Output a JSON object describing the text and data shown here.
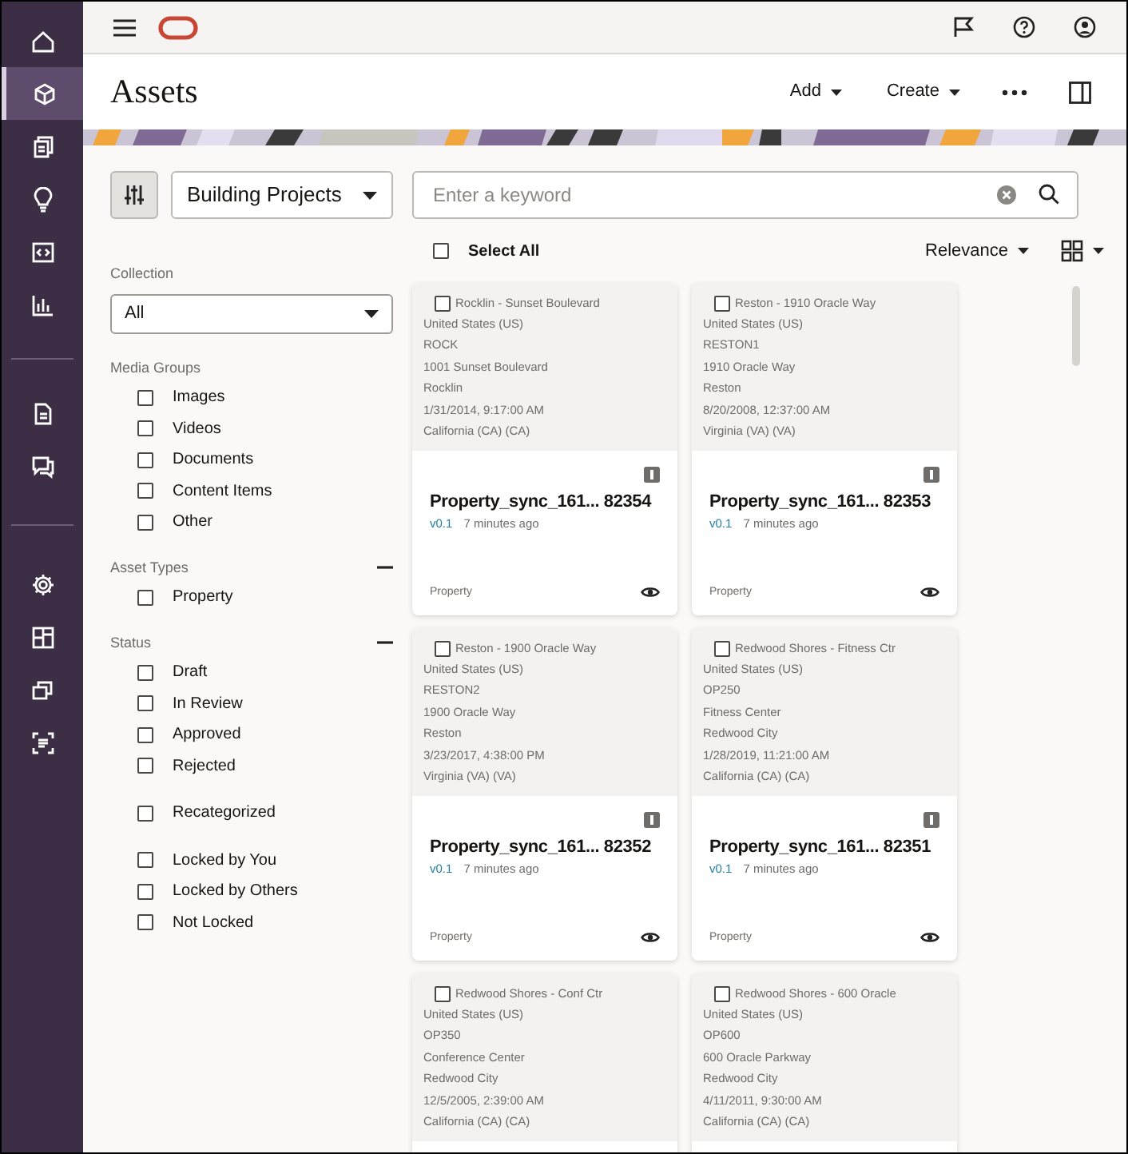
{
  "rail": {
    "items": [
      {
        "selected": false
      },
      {
        "selected": true
      },
      {
        "selected": false
      },
      {
        "selected": false
      },
      {
        "selected": false
      },
      {
        "selected": false
      },
      {
        "selected": false
      },
      {
        "selected": false
      },
      {
        "selected": false
      },
      {
        "selected": false
      },
      {
        "selected": false
      },
      {
        "selected": false
      }
    ]
  },
  "header": {
    "title": "Assets",
    "actions": [
      "Add",
      "Create"
    ]
  },
  "filters": {
    "repository": "Building Projects",
    "collection_label": "Collection",
    "collection": "All",
    "sections": [
      {
        "title": "Media Groups",
        "groups": [
          [
            {
              "label": "Images",
              "checked": false
            },
            {
              "label": "Videos",
              "checked": false
            },
            {
              "label": "Documents",
              "checked": false
            },
            {
              "label": "Content Items",
              "checked": false
            },
            {
              "label": "Other",
              "checked": false
            }
          ]
        ]
      },
      {
        "title": "Asset Types",
        "expanded": true,
        "groups": [
          [
            {
              "label": "Property",
              "checked": false
            }
          ]
        ]
      },
      {
        "title": "Status",
        "expanded": true,
        "groups": [
          [
            {
              "label": "Draft",
              "checked": false
            },
            {
              "label": "In Review",
              "checked": false
            },
            {
              "label": "Approved",
              "checked": false
            },
            {
              "label": "Rejected",
              "checked": false
            }
          ],
          [
            {
              "label": "Recategorized",
              "checked": false
            }
          ],
          [
            {
              "label": "Locked by You",
              "checked": false
            },
            {
              "label": "Locked by Others",
              "checked": false
            },
            {
              "label": "Not Locked",
              "checked": false
            }
          ]
        ]
      }
    ]
  },
  "search": {
    "placeholder": "Enter a keyword"
  },
  "toolbar": {
    "select_all": {
      "label": "Select All",
      "checked": false
    },
    "sort": "Relevance"
  },
  "cards": [
    {
      "checked": false,
      "title": "Rocklin - Sunset Boulevard",
      "lines": [
        "United States (US)",
        "ROCK",
        "1001 Sunset Boulevard",
        "Rocklin",
        "1/31/2014, 9:17:00 AM",
        "California (CA) (CA)"
      ],
      "name": "Property_sync_161... 82354",
      "version": "v0.1",
      "time": "7 minutes ago",
      "type": "Property"
    },
    {
      "checked": false,
      "title": "Reston - 1910 Oracle Way",
      "lines": [
        "United States (US)",
        "RESTON1",
        "1910 Oracle Way",
        "Reston",
        "8/20/2008, 12:37:00 AM",
        "Virginia (VA) (VA)"
      ],
      "name": "Property_sync_161... 82353",
      "version": "v0.1",
      "time": "7 minutes ago",
      "type": "Property"
    },
    {
      "checked": false,
      "title": "Reston - 1900 Oracle Way",
      "lines": [
        "United States (US)",
        "RESTON2",
        "1900 Oracle Way",
        "Reston",
        "3/23/2017, 4:38:00 PM",
        "Virginia (VA) (VA)"
      ],
      "name": "Property_sync_161... 82352",
      "version": "v0.1",
      "time": "7 minutes ago",
      "type": "Property"
    },
    {
      "checked": false,
      "title": "Redwood Shores - Fitness Ctr",
      "lines": [
        "United States (US)",
        "OP250",
        "Fitness Center",
        "Redwood City",
        "1/28/2019, 11:21:00 AM",
        "California (CA) (CA)"
      ],
      "name": "Property_sync_161... 82351",
      "version": "v0.1",
      "time": "7 minutes ago",
      "type": "Property"
    },
    {
      "checked": false,
      "title": "Redwood Shores - Conf Ctr",
      "lines": [
        "United States (US)",
        "OP350",
        "Conference Center",
        "Redwood City",
        "12/5/2005, 2:39:00 AM",
        "California (CA) (CA)"
      ]
    },
    {
      "checked": false,
      "title": "Redwood Shores - 600 Oracle",
      "lines": [
        "United States (US)",
        "OP600",
        "600 Oracle Parkway",
        "Redwood City",
        "4/11/2011, 9:30:00 AM",
        "California (CA) (CA)"
      ]
    }
  ]
}
